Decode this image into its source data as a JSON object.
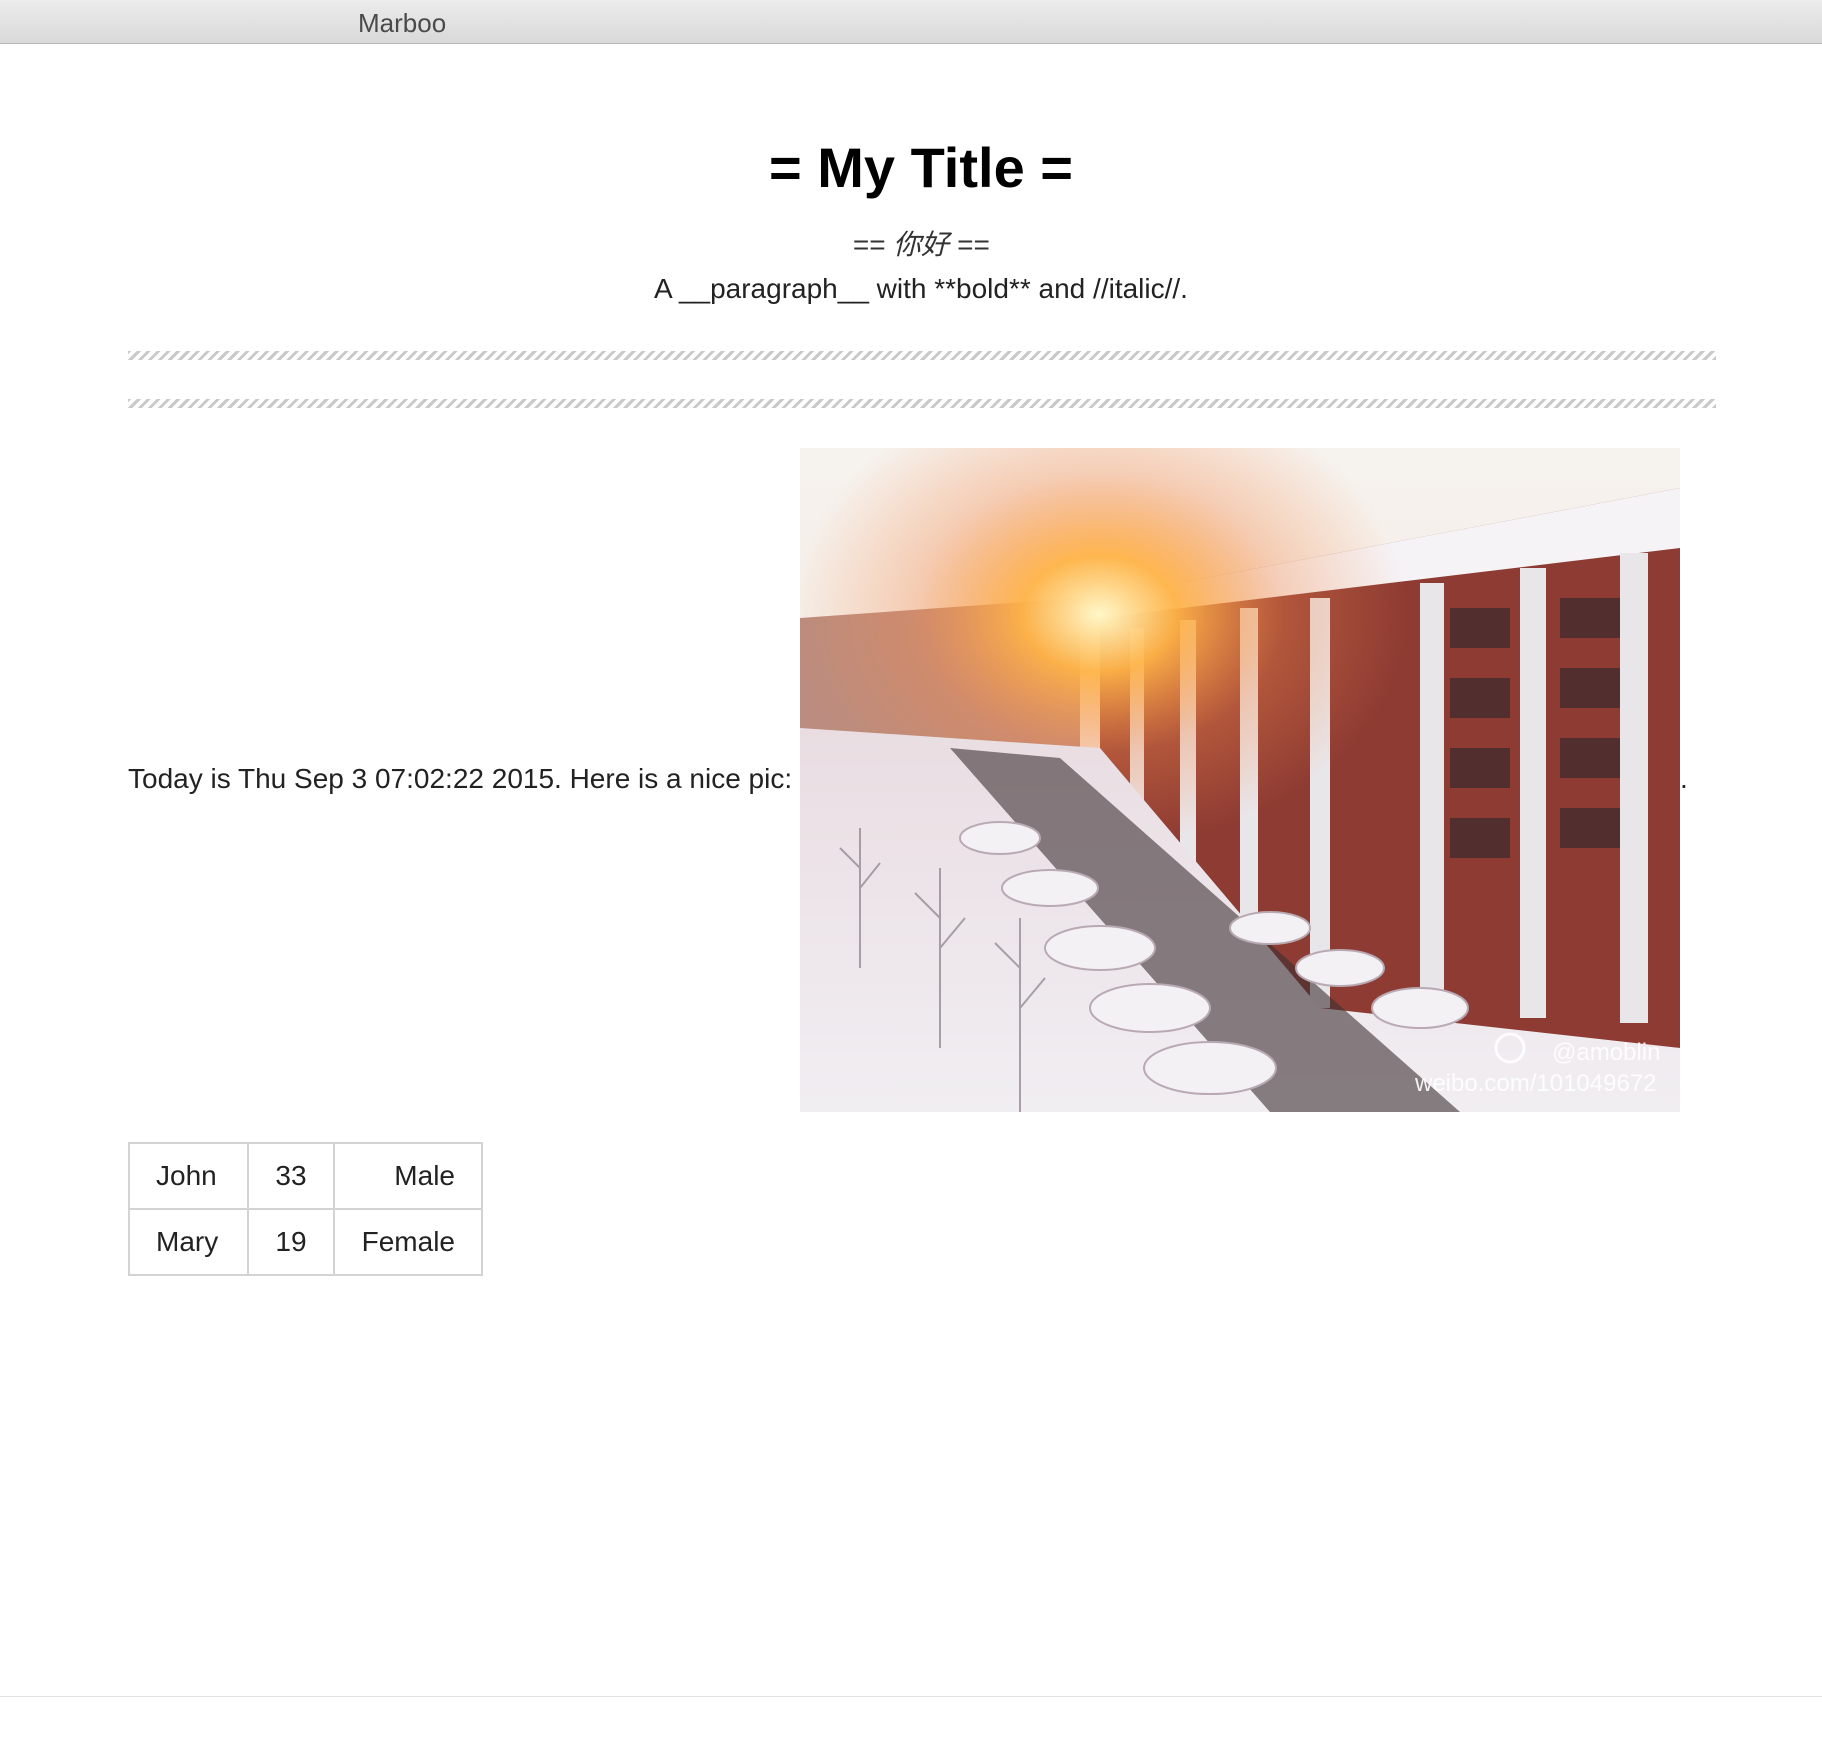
{
  "window": {
    "app_title": "Marboo"
  },
  "document": {
    "title": "= My Title =",
    "subtitle": "== 你好 ==",
    "paragraph": "A __paragraph__ with **bold** and //italic//.",
    "pic_text": "Today is Thu Sep 3 07:02:22 2015. Here is a nice pic:",
    "pic_period": ".",
    "photo": {
      "watermark_handle": "@amoblin",
      "watermark_url": "weibo.com/101049672"
    },
    "table": {
      "rows": [
        {
          "name": "John",
          "age": "33",
          "sex": "Male"
        },
        {
          "name": "Mary",
          "age": "19",
          "sex": "Female"
        }
      ]
    }
  }
}
